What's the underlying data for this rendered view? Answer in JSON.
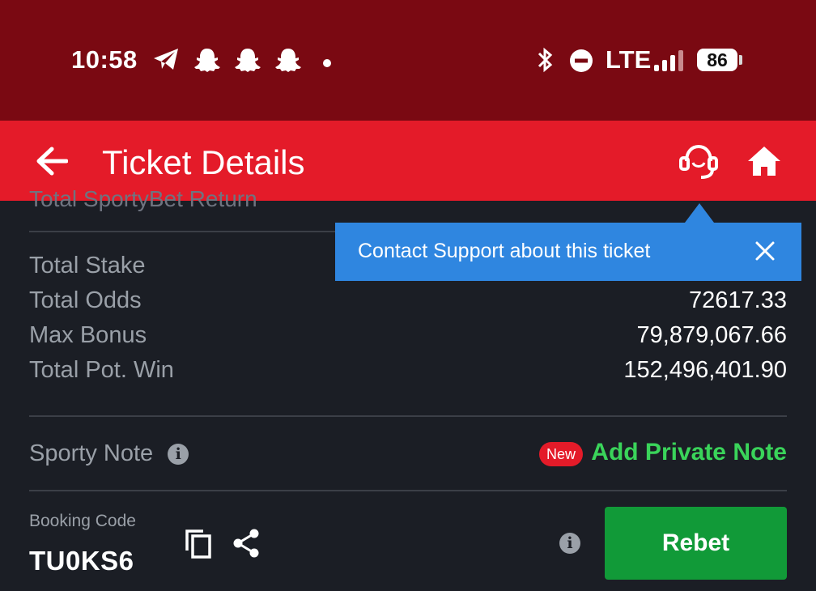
{
  "status_bar": {
    "time": "10:58",
    "network": "LTE",
    "battery": "86",
    "icons": [
      "telegram-icon",
      "snapchat-icon",
      "snapchat-icon",
      "snapchat-icon",
      "dot-icon",
      "bluetooth-icon",
      "do-not-disturb-icon",
      "signal-icon"
    ]
  },
  "app_bar": {
    "title": "Ticket Details",
    "icons": [
      "back-arrow-icon",
      "support-headset-icon",
      "home-icon"
    ]
  },
  "tooltip": {
    "text": "Contact Support about this ticket",
    "close_icon": "close-icon"
  },
  "summary": {
    "cutoff_label": "Total SportyBet Return",
    "rows": [
      {
        "label": "Total Stake",
        "value": ""
      },
      {
        "label": "Total Odds",
        "value": "72617.33"
      },
      {
        "label": "Max Bonus",
        "value": "79,879,067.66"
      },
      {
        "label": "Total Pot. Win",
        "value": "152,496,401.90"
      }
    ]
  },
  "note": {
    "label": "Sporty Note",
    "new_badge": "New",
    "add_label": "Add Private Note",
    "info_glyph": "i"
  },
  "booking": {
    "label": "Booking Code",
    "code": "TU0KS6",
    "rebet_label": "Rebet",
    "info_glyph": "i"
  },
  "colors": {
    "status_bar": "#7a0912",
    "app_bar": "#e41b29",
    "background": "#1b1e25",
    "tooltip": "#2f86e0",
    "accent_green": "#3ad45a",
    "rebet_button": "#119a38"
  }
}
